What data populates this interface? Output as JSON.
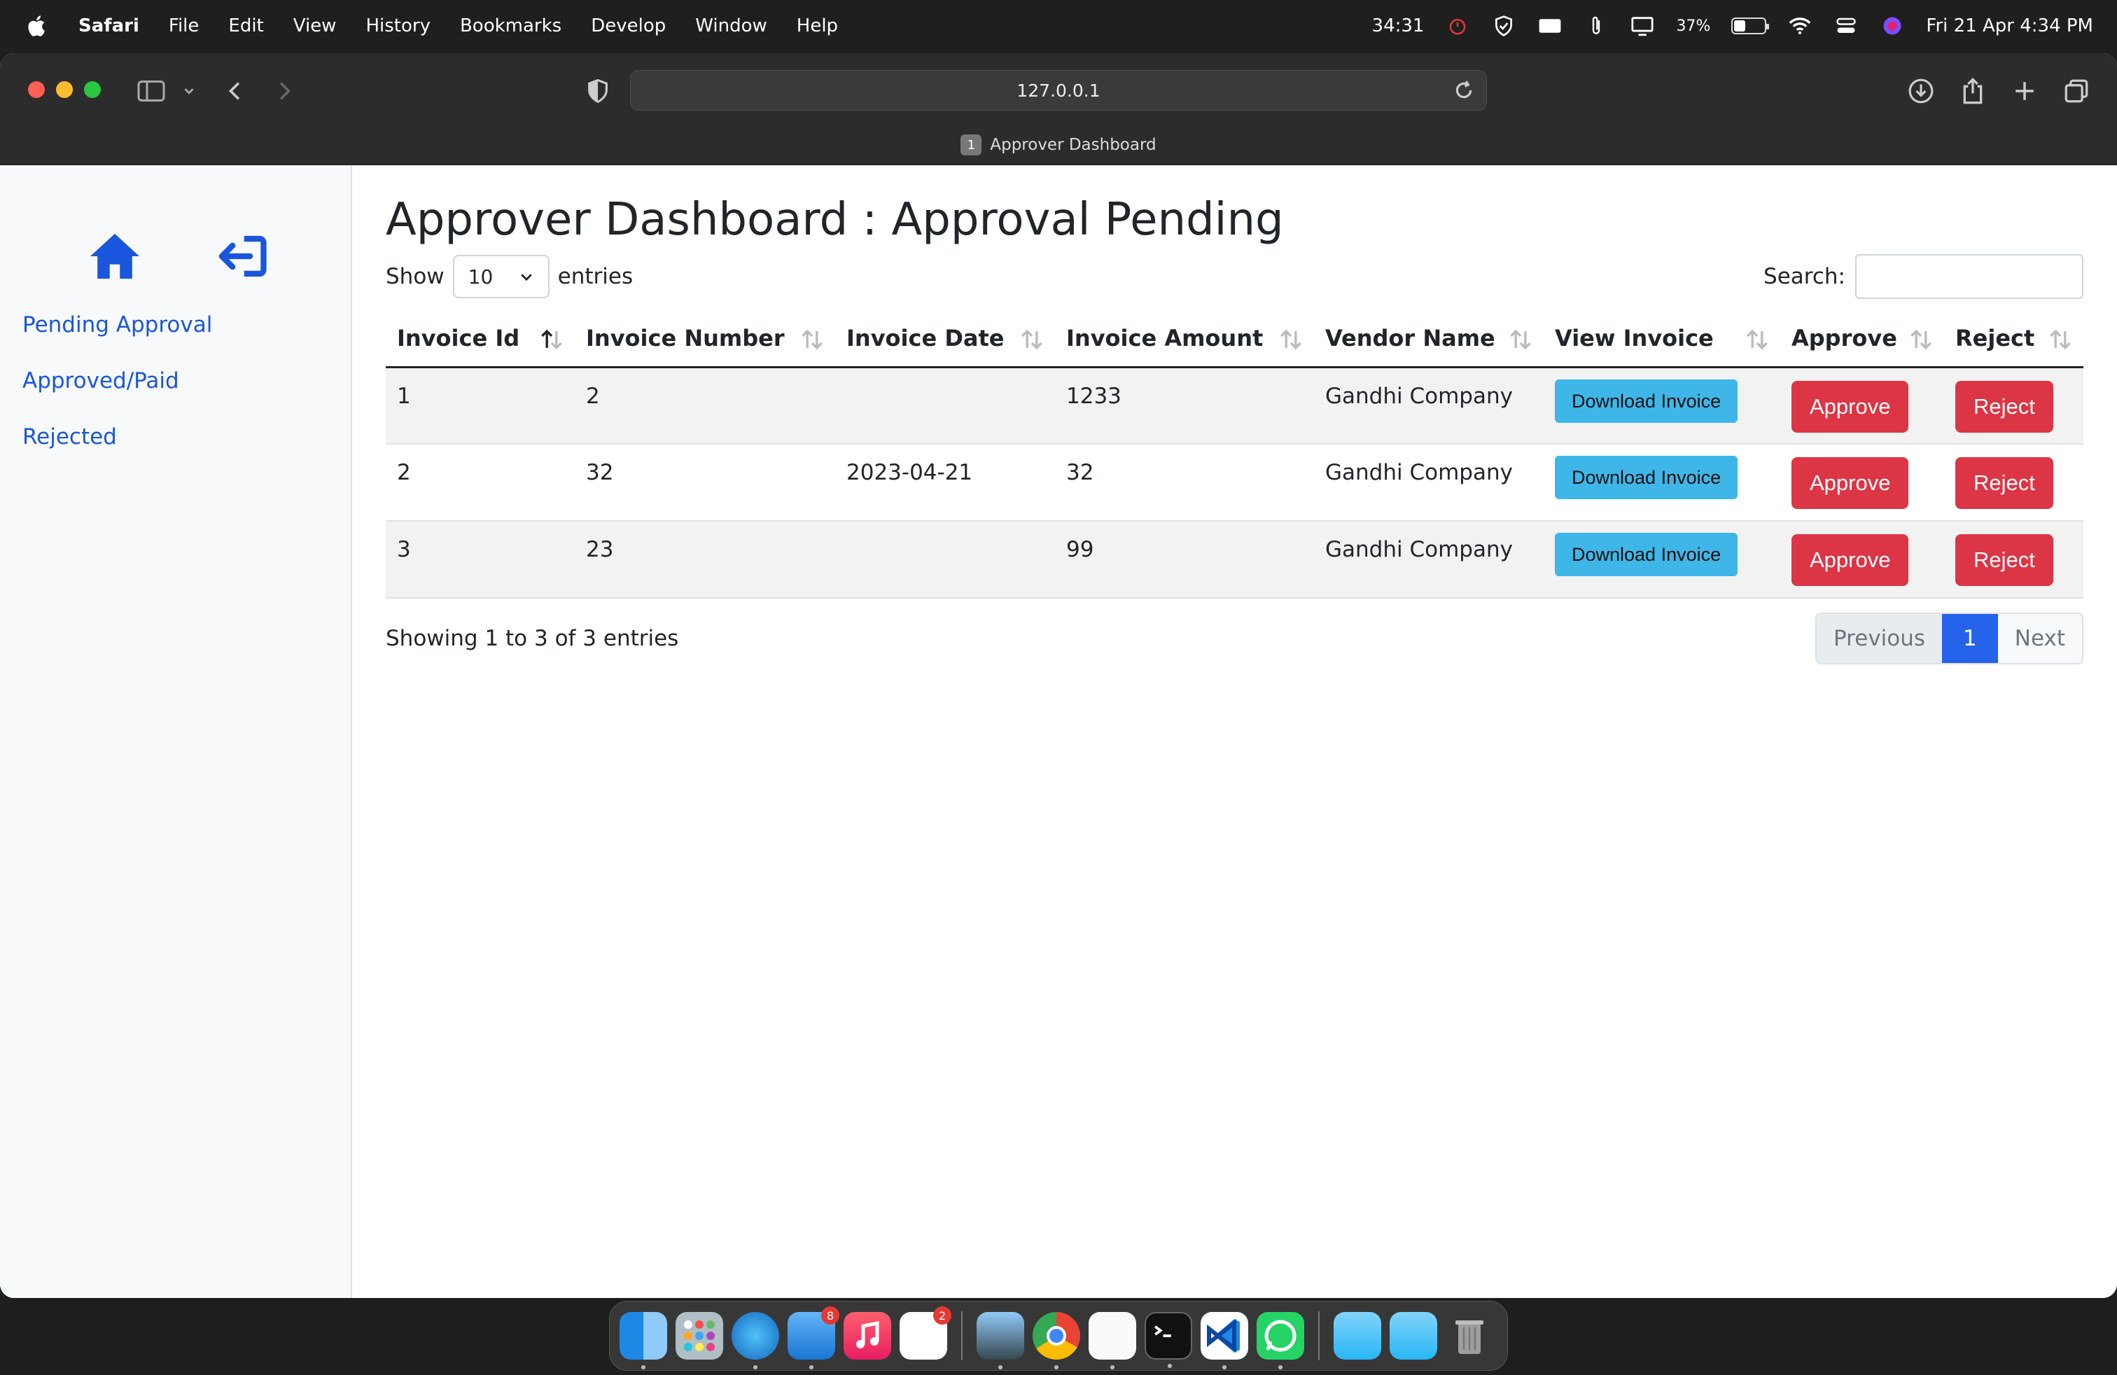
{
  "menubar": {
    "app": "Safari",
    "items": [
      "File",
      "Edit",
      "View",
      "History",
      "Bookmarks",
      "Develop",
      "Window",
      "Help"
    ],
    "timer": "34:31",
    "battery": "37%",
    "battery_level": 0.37,
    "datetime": "Fri 21 Apr  4:34 PM"
  },
  "browser": {
    "url": "127.0.0.1",
    "tab_count": "1",
    "tab_title": "Approver Dashboard"
  },
  "sidebar": {
    "nav": [
      "Pending Approval",
      "Approved/Paid",
      "Rejected"
    ]
  },
  "page": {
    "title": "Approver Dashboard : Approval Pending",
    "show_label": "Show",
    "entries_value": "10",
    "entries_label": "entries",
    "search_label": "Search:",
    "search_value": ""
  },
  "table": {
    "columns": [
      "Invoice Id",
      "Invoice Number",
      "Invoice Date",
      "Invoice Amount",
      "Vendor Name",
      "View Invoice",
      "Approve",
      "Reject"
    ],
    "rows": [
      {
        "id": "1",
        "number": "2",
        "date": "",
        "amount": "1233",
        "vendor": "Gandhi Company"
      },
      {
        "id": "2",
        "number": "32",
        "date": "2023-04-21",
        "amount": "32",
        "vendor": "Gandhi Company"
      },
      {
        "id": "3",
        "number": "23",
        "date": "",
        "amount": "99",
        "vendor": "Gandhi Company"
      }
    ],
    "download_label": "Download Invoice",
    "approve_label": "Approve",
    "reject_label": "Reject"
  },
  "footer": {
    "info": "Showing 1 to 3 of 3 entries",
    "prev": "Previous",
    "page": "1",
    "next": "Next"
  },
  "dock": {
    "badges": {
      "mail": "8",
      "reminders": "2"
    }
  },
  "colors": {
    "link": "#1a56db",
    "danger": "#dc3545",
    "info": "#3fb6e8",
    "primary": "#2563eb"
  }
}
